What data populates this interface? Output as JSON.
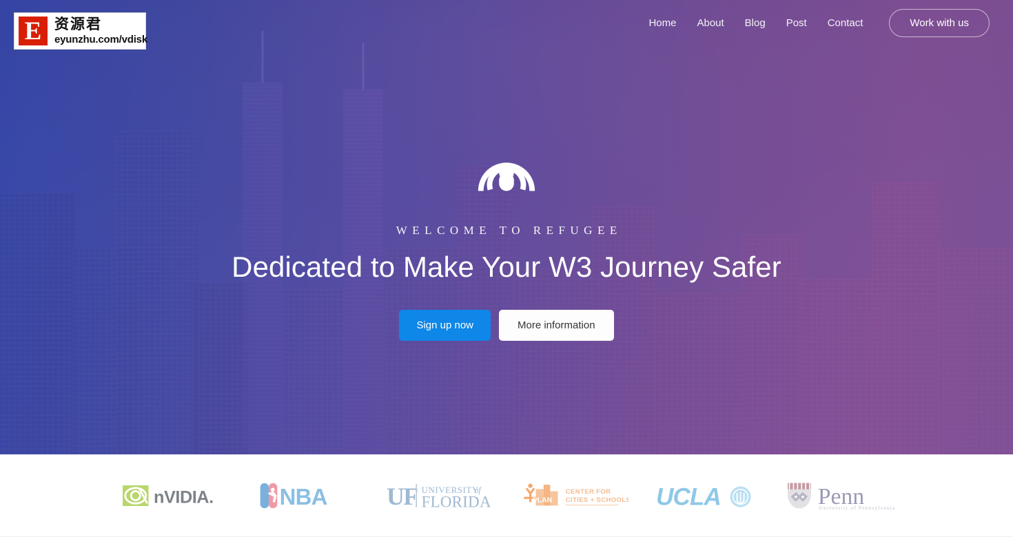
{
  "brand": {
    "name": "Refugee"
  },
  "nav": {
    "links": [
      {
        "label": "Home"
      },
      {
        "label": "About"
      },
      {
        "label": "Blog"
      },
      {
        "label": "Post"
      },
      {
        "label": "Contact"
      }
    ],
    "cta": {
      "label": "Work with us"
    }
  },
  "hero": {
    "icon": "broadcast-signal-icon",
    "eyebrow": "WELCOME TO REFUGEE",
    "headline": "Dedicated to Make Your W3 Journey Safer",
    "buttons": {
      "primary": {
        "label": "Sign up now",
        "color": "#0e87e8"
      },
      "secondary": {
        "label": "More information",
        "color": "#fdfdfd"
      }
    },
    "background": {
      "type": "cityscape-photo",
      "overlay_from": "#3c46af",
      "overlay_to": "#92509 6"
    }
  },
  "partners": {
    "items": [
      {
        "name": "NVIDIA",
        "text": "nVIDIA.",
        "color": "#7a7f85",
        "mark_color": "#a8cc5a"
      },
      {
        "name": "NBA",
        "text": "NBA",
        "color": "#8fc0e8",
        "mark_color": "#f3a3ae"
      },
      {
        "name": "University of Florida",
        "line1": "UNIVERSITY of",
        "line2": "FLORIDA",
        "abbr": "UF",
        "color": "#9bb6cf"
      },
      {
        "name": "Y-PLAN Center for Cities and Schools",
        "abbr": "Y-PLAN",
        "line1": "CENTER FOR",
        "line2": "CITIES + SCHOOLS",
        "color": "#f5c199"
      },
      {
        "name": "UCLA",
        "text": "UCLA",
        "color": "#8fc8e8"
      },
      {
        "name": "University of Pennsylvania",
        "text": "Penn",
        "subtitle": "University of Pennsylvania",
        "color": "#9b9ab5",
        "mark_color": "#b98a92"
      }
    ]
  },
  "watermark": {
    "letter": "E",
    "cn_text": "资源君",
    "url": "eyunzhu.com/vdisk"
  }
}
